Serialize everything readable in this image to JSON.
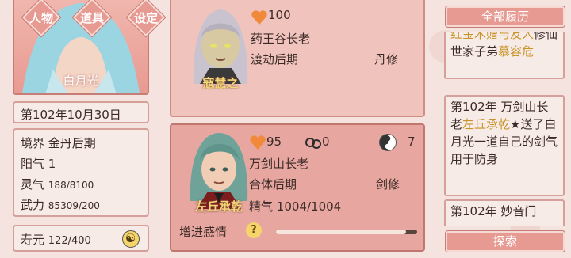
{
  "menu": {
    "character": "人物",
    "items": "道具",
    "settings": "设定"
  },
  "player": {
    "name": "白月光",
    "date": "第102年10月30日",
    "realm_label": "境界",
    "realm": "金丹后期",
    "yang_label": "阳气",
    "yang": "1",
    "qi_label": "灵气",
    "qi": "188/8100",
    "force_label": "武力",
    "force": "85309/200",
    "life_label": "寿元",
    "life": "122/400"
  },
  "cards": [
    {
      "name": "寇慧之",
      "favor": "100",
      "title": "药王谷长老",
      "realm": "渡劫后期",
      "cultivation": "丹修"
    },
    {
      "name": "左丘承乾",
      "favor": "95",
      "shackles": "0",
      "karma": "7",
      "title": "万剑山长老",
      "realm": "合体后期",
      "cultivation": "剑修",
      "essence_label": "精气",
      "essence": "1004/1004",
      "boost_label": "增进感情",
      "boost_progress": 0.92
    }
  ],
  "history": {
    "title": "全部履历",
    "entries": [
      {
        "pre": "",
        "hl": "红金木赠与友人",
        "post": "修仙世家子弟",
        "hl2": "慕容危",
        "post2": ""
      },
      {
        "pre": "第102年 万剑山长老",
        "hl": "左丘承乾",
        "post": "★送了白月光一道自己的剑气用于防身",
        "hl2": "",
        "post2": ""
      },
      {
        "pre": "第102年 妙音门",
        "hl": "",
        "post": "",
        "hl2": "",
        "post2": ""
      }
    ],
    "search": "探索"
  },
  "colors": {
    "accent": "#e79a92",
    "gold": "#f3d777",
    "highlight": "#c8942a"
  }
}
